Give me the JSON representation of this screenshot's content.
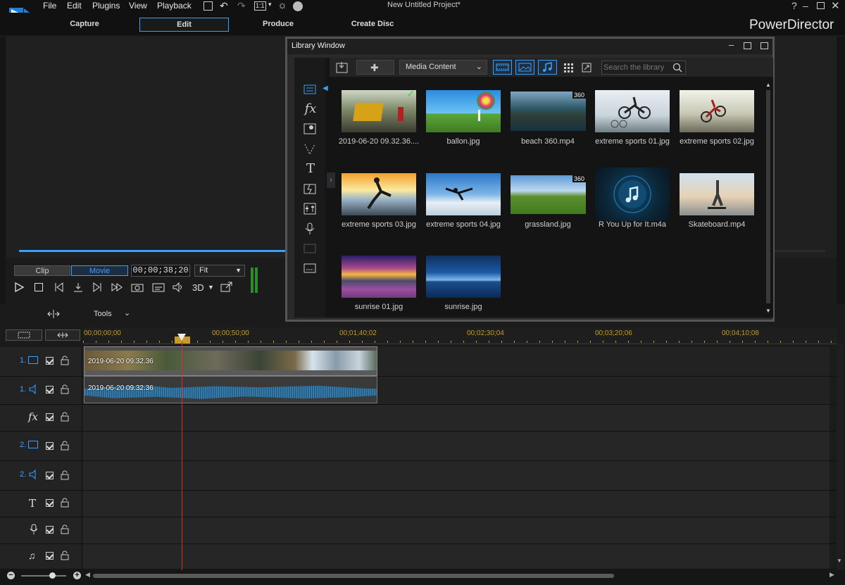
{
  "app": {
    "title": "New Untitled Project*",
    "brand": "PowerDirector"
  },
  "menu": [
    "File",
    "Edit",
    "Plugins",
    "View",
    "Playback"
  ],
  "toolbar": {
    "zoom_label": "1:1"
  },
  "modes": [
    {
      "label": "Capture"
    },
    {
      "label": "Edit",
      "active": true
    },
    {
      "label": "Produce"
    },
    {
      "label": "Create Disc"
    }
  ],
  "player": {
    "clip_label": "Clip",
    "movie_label": "Movie",
    "timecode": "00;00;38;20",
    "fit_option": "Fit",
    "three_d_label": "3D"
  },
  "tools": {
    "label": "Tools"
  },
  "library": {
    "title": "Library Window",
    "content_filter": "Media Content",
    "search_placeholder": "Search the library",
    "items": [
      {
        "caption": "2019-06-20 09.32.36....",
        "kind": "video",
        "checked": true
      },
      {
        "caption": "ballon.jpg",
        "kind": "image"
      },
      {
        "caption": "beach 360.mp4",
        "kind": "video",
        "badge": "360"
      },
      {
        "caption": "extreme sports 01.jpg",
        "kind": "image"
      },
      {
        "caption": "extreme sports 02.jpg",
        "kind": "image"
      },
      {
        "caption": "extreme sports 03.jpg",
        "kind": "image"
      },
      {
        "caption": "extreme sports 04.jpg",
        "kind": "image"
      },
      {
        "caption": "grassland.jpg",
        "kind": "image",
        "badge": "360"
      },
      {
        "caption": "R You Up for It.m4a",
        "kind": "audio"
      },
      {
        "caption": "Skateboard.mp4",
        "kind": "video"
      },
      {
        "caption": "sunrise 01.jpg",
        "kind": "image"
      },
      {
        "caption": "sunrise.jpg",
        "kind": "image"
      }
    ]
  },
  "timeline": {
    "ruler": [
      "00;00;00;00",
      "00;00;50;00",
      "00;01;40;02",
      "00;02;30;04",
      "00;03;20;06",
      "00;04;10;08"
    ],
    "tracks": [
      {
        "label": "1.",
        "icon": "video-track-icon"
      },
      {
        "label": "1.",
        "icon": "audio-track-icon"
      },
      {
        "label": "",
        "icon": "fx-track-icon"
      },
      {
        "label": "2.",
        "icon": "video-track-icon"
      },
      {
        "label": "2.",
        "icon": "audio-track-icon"
      },
      {
        "label": "",
        "icon": "title-track-icon"
      },
      {
        "label": "",
        "icon": "voice-track-icon"
      },
      {
        "label": "",
        "icon": "music-track-icon"
      }
    ],
    "video_clip_label": "2019-06-20 09.32.36",
    "audio_clip_label": "2019-06-20 09.32.36"
  },
  "colors": {
    "accent": "#3aa0ff",
    "playhead": "#c0392b",
    "ruler_text": "#c79b2a"
  }
}
